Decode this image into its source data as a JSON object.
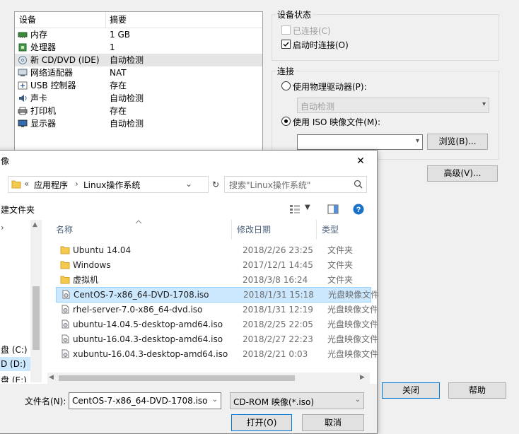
{
  "devices": {
    "header": {
      "device": "设备",
      "summary": "摘要"
    },
    "rows": [
      {
        "name": "内存",
        "summary": "1 GB",
        "icon": "memory-icon"
      },
      {
        "name": "处理器",
        "summary": "1",
        "icon": "processor-icon"
      },
      {
        "name": "新 CD/DVD (IDE)",
        "summary": "自动检测",
        "icon": "cd-dvd-icon"
      },
      {
        "name": "网络适配器",
        "summary": "NAT",
        "icon": "network-adapter-icon"
      },
      {
        "name": "USB 控制器",
        "summary": "存在",
        "icon": "usb-icon"
      },
      {
        "name": "声卡",
        "summary": "自动检测",
        "icon": "sound-card-icon"
      },
      {
        "name": "打印机",
        "summary": "存在",
        "icon": "printer-icon"
      },
      {
        "name": "显示器",
        "summary": "自动检测",
        "icon": "display-icon"
      }
    ]
  },
  "device_status": {
    "title": "设备状态",
    "connected_label": "已连接(C)",
    "connect_on_start_label": "启动时连接(O)"
  },
  "connection": {
    "title": "连接",
    "physical_drive_label": "使用物理驱动器(P):",
    "physical_drive_value": "自动检测",
    "iso_label": "使用 ISO 映像文件(M):",
    "browse_label": "浏览(B)..."
  },
  "advanced_label": "高级(V)...",
  "close_label": "关闭",
  "help_label": "帮助",
  "file_dialog": {
    "title": "像",
    "breadcrumb": [
      "«",
      "应用程序",
      "Linux操作系统"
    ],
    "search_placeholder": "搜索\"Linux操作系统\"",
    "new_folder_label": "建文件夹",
    "columns": {
      "name": "名称",
      "date": "修改日期",
      "type": "类型"
    },
    "nav_items": [
      {
        "label": "盘 (C:)"
      },
      {
        "label": "D (D:)"
      },
      {
        "label": "盘 (E:)"
      }
    ],
    "files": [
      {
        "name": "Ubuntu 14.04",
        "date": "2018/2/26 23:25",
        "type": "文件夹",
        "kind": "folder"
      },
      {
        "name": "Windows",
        "date": "2017/12/1 14:45",
        "type": "文件夹",
        "kind": "folder"
      },
      {
        "name": "虚拟机",
        "date": "2018/3/8 16:24",
        "type": "文件夹",
        "kind": "folder"
      },
      {
        "name": "CentOS-7-x86_64-DVD-1708.iso",
        "date": "2018/1/31 15:18",
        "type": "光盘映像文件",
        "kind": "iso"
      },
      {
        "name": "rhel-server-7.0-x86_64-dvd.iso",
        "date": "2018/1/31 12:19",
        "type": "光盘映像文件",
        "kind": "iso"
      },
      {
        "name": "ubuntu-14.04.5-desktop-amd64.iso",
        "date": "2018/2/25 22:05",
        "type": "光盘映像文件",
        "kind": "iso"
      },
      {
        "name": "ubuntu-16.04.3-desktop-amd64.iso",
        "date": "2018/2/27 22:23",
        "type": "光盘映像文件",
        "kind": "iso"
      },
      {
        "name": "xubuntu-16.04.3-desktop-amd64.iso",
        "date": "2018/2/21 0:03",
        "type": "光盘映像文件",
        "kind": "iso"
      }
    ],
    "filename_label": "文件名(N):",
    "filename_value": "CentOS-7-x86_64-DVD-1708.iso",
    "filetype_value": "CD-ROM 映像(*.iso)",
    "open_label": "打开(O)",
    "cancel_label": "取消"
  }
}
